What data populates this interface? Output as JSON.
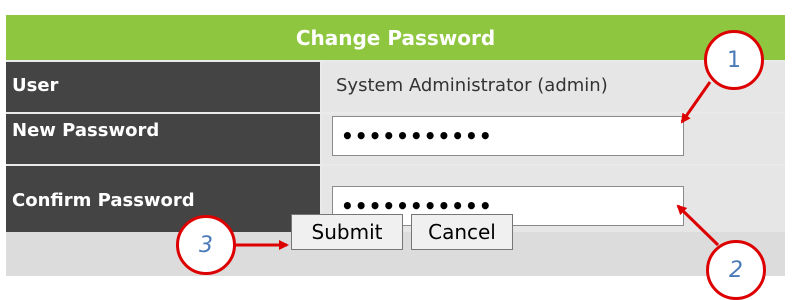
{
  "dialog": {
    "title": "Change Password"
  },
  "fields": {
    "user_label": "User",
    "user_value": "System Administrator (admin)",
    "new_password_label": "New Password",
    "new_password_value": "•••••••••••",
    "confirm_password_label": "Confirm Password",
    "confirm_password_value": "•••••••••••"
  },
  "buttons": {
    "submit_label": "Submit",
    "cancel_label": "Cancel"
  },
  "callouts": {
    "one": "1",
    "two": "2",
    "three": "3"
  },
  "colors": {
    "header_green": "#8ec73f",
    "label_dark": "#444444",
    "callout_red": "#dd0000",
    "callout_number_blue": "#4a7ab8"
  }
}
